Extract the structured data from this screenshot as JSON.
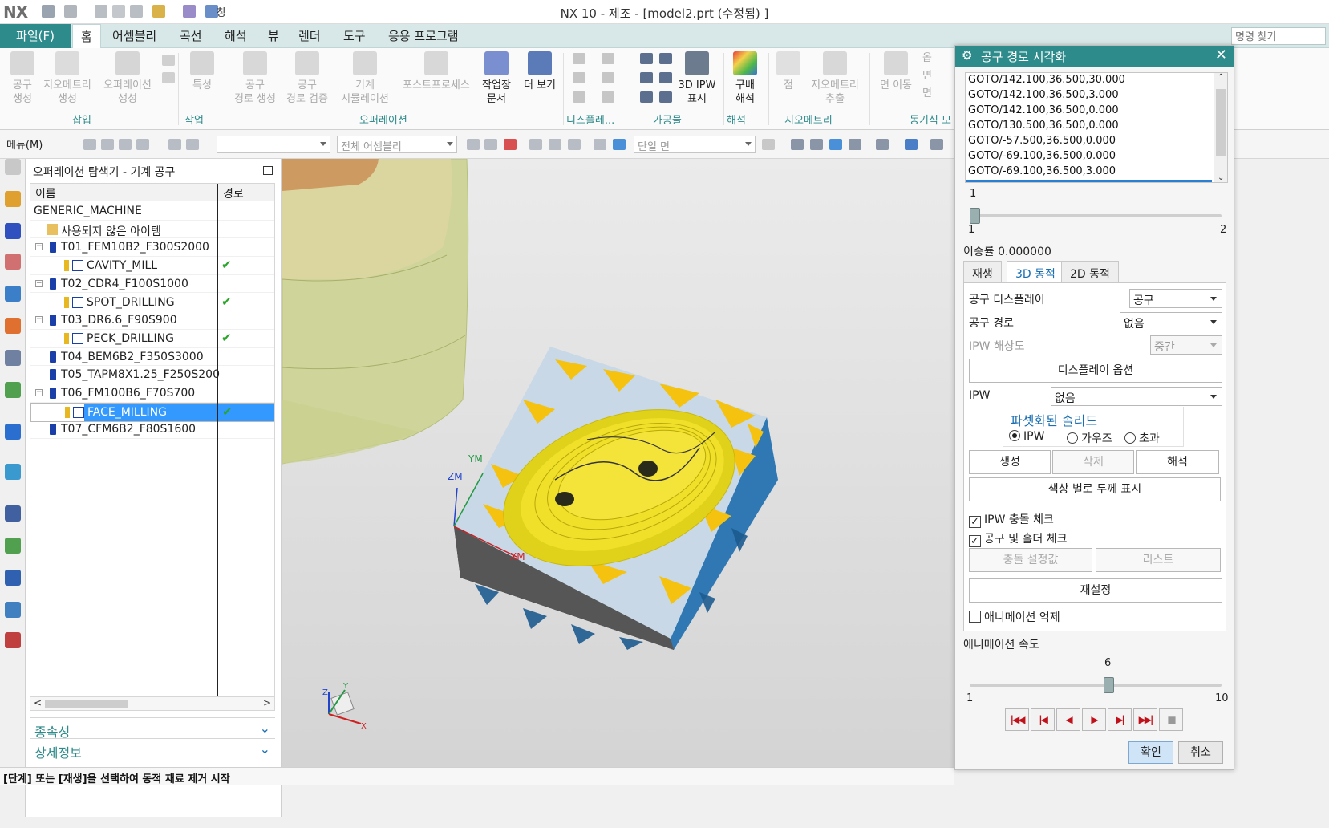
{
  "app": {
    "logo": "NX",
    "window_menu": "창",
    "title": "NX 10 - 제조 - [model2.prt (수정됨) ]"
  },
  "ribbon_tabs": {
    "file": "파일(F)",
    "items": [
      "홈",
      "어셈블리",
      "곡선",
      "해석",
      "뷰",
      "렌더",
      "도구",
      "응용 프로그램"
    ],
    "active": "홈",
    "search_placeholder": "명령 찾기"
  },
  "ribbon": {
    "buttons": [
      {
        "l1": "공구",
        "l2": "생성"
      },
      {
        "l1": "지오메트리",
        "l2": "생성"
      },
      {
        "l1": "오퍼레이션",
        "l2": "생성"
      },
      {
        "l1": "특성",
        "l2": ""
      },
      {
        "l1": "공구",
        "l2": "경로 생성"
      },
      {
        "l1": "공구",
        "l2": "경로 검증"
      },
      {
        "l1": "기계",
        "l2": "시뮬레이션"
      },
      {
        "l1": "포스트프로세스",
        "l2": ""
      },
      {
        "l1": "작업장",
        "l2": "문서"
      },
      {
        "l1": "더 보기",
        "l2": ""
      },
      {
        "l1": "3D IPW",
        "l2": "표시"
      },
      {
        "l1": "구배",
        "l2": "해석"
      },
      {
        "l1": "점",
        "l2": ""
      },
      {
        "l1": "지오메트리",
        "l2": "추출"
      },
      {
        "l1": "면 이동",
        "l2": ""
      }
    ],
    "small_labels": [
      "옵",
      "면",
      "면"
    ],
    "groups": [
      "삽입",
      "작업",
      "오퍼레이션",
      "디스플레...",
      "가공물",
      "해석",
      "지오메트리",
      "동기식 모"
    ]
  },
  "toolbar2": {
    "menu": "메뉴(M)",
    "filter_value": "",
    "assembly_scope": "전체 어셈블리",
    "select_mode": "단일 면"
  },
  "navigator": {
    "title": "오퍼레이션 탐색기 - 기계 공구",
    "col_name": "이름",
    "col_path": "경로",
    "rows": [
      {
        "label": "GENERIC_MACHINE",
        "type": "root",
        "check": ""
      },
      {
        "label": "사용되지 않은 아이템",
        "type": "folder",
        "check": ""
      },
      {
        "label": "T01_FEM10B2_F300S2000",
        "type": "tool",
        "check": ""
      },
      {
        "label": "CAVITY_MILL",
        "type": "op",
        "check": "✔"
      },
      {
        "label": "T02_CDR4_F100S1000",
        "type": "tool",
        "check": ""
      },
      {
        "label": "SPOT_DRILLING",
        "type": "op",
        "check": "✔"
      },
      {
        "label": "T03_DR6.6_F90S900",
        "type": "tool",
        "check": ""
      },
      {
        "label": "PECK_DRILLING",
        "type": "op",
        "check": "✔"
      },
      {
        "label": "T04_BEM6B2_F350S3000",
        "type": "tool-leaf",
        "check": ""
      },
      {
        "label": "T05_TAPM8X1.25_F250S200",
        "type": "tool-leaf",
        "check": ""
      },
      {
        "label": "T06_FM100B6_F70S700",
        "type": "tool",
        "check": ""
      },
      {
        "label": "FACE_MILLING",
        "type": "op-selected",
        "check": "✔"
      },
      {
        "label": "T07_CFM6B2_F80S1600",
        "type": "tool-leaf",
        "check": ""
      }
    ],
    "sections": [
      "종속성",
      "상세정보"
    ]
  },
  "viewport": {
    "axis_labels": [
      "YM",
      "ZM",
      "XM"
    ],
    "triad_labels": [
      "Z",
      "Y",
      "X"
    ]
  },
  "status": {
    "text": "[단계] 또는 [재생]을 선택하여 동적 재료 제거 시작"
  },
  "dialog": {
    "title": "공구 경로 시각화",
    "gcode": [
      "GOTO/142.100,36.500,30.000",
      "GOTO/142.100,36.500,3.000",
      "GOTO/142.100,36.500,0.000",
      "GOTO/130.500,36.500,0.000",
      "GOTO/-57.500,36.500,0.000",
      "GOTO/-69.100,36.500,0.000",
      "GOTO/-69.100,36.500,3.000"
    ],
    "slider1": {
      "current": "1",
      "min": "1",
      "max": "2",
      "value": 1,
      "range_min": 1,
      "range_max": 2
    },
    "feed_rate": "이송률 0.000000",
    "tabs": [
      "재생",
      "3D 동적",
      "2D 동적"
    ],
    "active_tab": "3D 동적",
    "tool_display_label": "공구 디스플레이",
    "tool_display_value": "공구",
    "toolpath_label": "공구 경로",
    "toolpath_value": "없음",
    "ipw_res_label": "IPW 해상도",
    "ipw_res_value": "중간",
    "display_options": "디스플레이 옵션",
    "ipw_label": "IPW",
    "ipw_value": "없음",
    "facet_title": "파셋화된 솔리드",
    "radios": [
      "IPW",
      "가우즈",
      "초과"
    ],
    "btn_create": "생성",
    "btn_delete": "삭제",
    "btn_analyze": "해석",
    "btn_color_thickness": "색상 별로 두께 표시",
    "check_ipw_collision": "IPW 충돌 체크",
    "check_tool_holder": "공구 및 홀더 체크",
    "btn_collision_settings": "충돌 설정값",
    "btn_list": "리스트",
    "btn_reset": "재설정",
    "check_suppress_anim": "애니메이션 억제",
    "anim_speed_label": "애니메이션 속도",
    "slider2": {
      "current": "6",
      "min": "1",
      "max": "10",
      "value": 6,
      "range_min": 1,
      "range_max": 10
    },
    "ok": "확인",
    "cancel": "취소"
  }
}
